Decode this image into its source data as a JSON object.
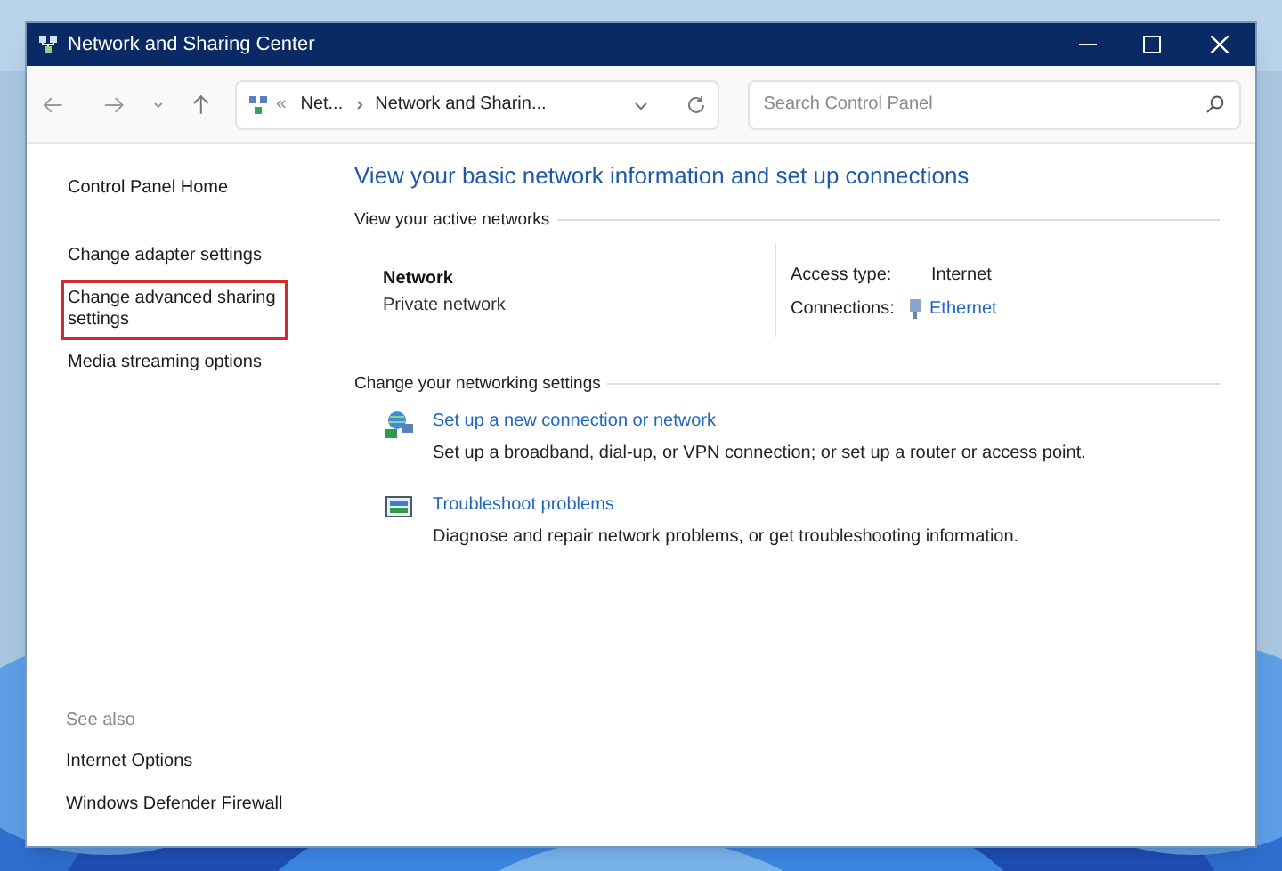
{
  "window": {
    "title": "Network and Sharing Center"
  },
  "address_bar": {
    "overflow": "«",
    "path": [
      "Net...",
      "Network and Sharin..."
    ]
  },
  "search": {
    "placeholder": "Search Control Panel"
  },
  "sidebar": {
    "items": [
      {
        "label": "Control Panel Home",
        "highlighted": false
      },
      {
        "label": "Change adapter settings",
        "highlighted": false
      },
      {
        "label": "Change advanced sharing settings",
        "highlighted": true
      },
      {
        "label": "Media streaming options",
        "highlighted": false
      }
    ],
    "see_also": {
      "heading": "See also",
      "items": [
        "Internet Options",
        "Windows Defender Firewall"
      ]
    }
  },
  "main": {
    "heading": "View your basic network information and set up connections",
    "active_networks": {
      "label": "View your active networks",
      "network_name": "Network",
      "network_type": "Private network",
      "access_type": {
        "label": "Access type:",
        "value": "Internet"
      },
      "connections": {
        "label": "Connections:",
        "value": "Ethernet"
      }
    },
    "settings": {
      "label": "Change your networking settings",
      "tasks": [
        {
          "kind": "setup",
          "title": "Set up a new connection or network",
          "description": "Set up a broadband, dial-up, or VPN connection; or set up a router or access point."
        },
        {
          "kind": "troubleshoot",
          "title": "Troubleshoot problems",
          "description": "Diagnose and repair network problems, or get troubleshooting information."
        }
      ]
    }
  }
}
